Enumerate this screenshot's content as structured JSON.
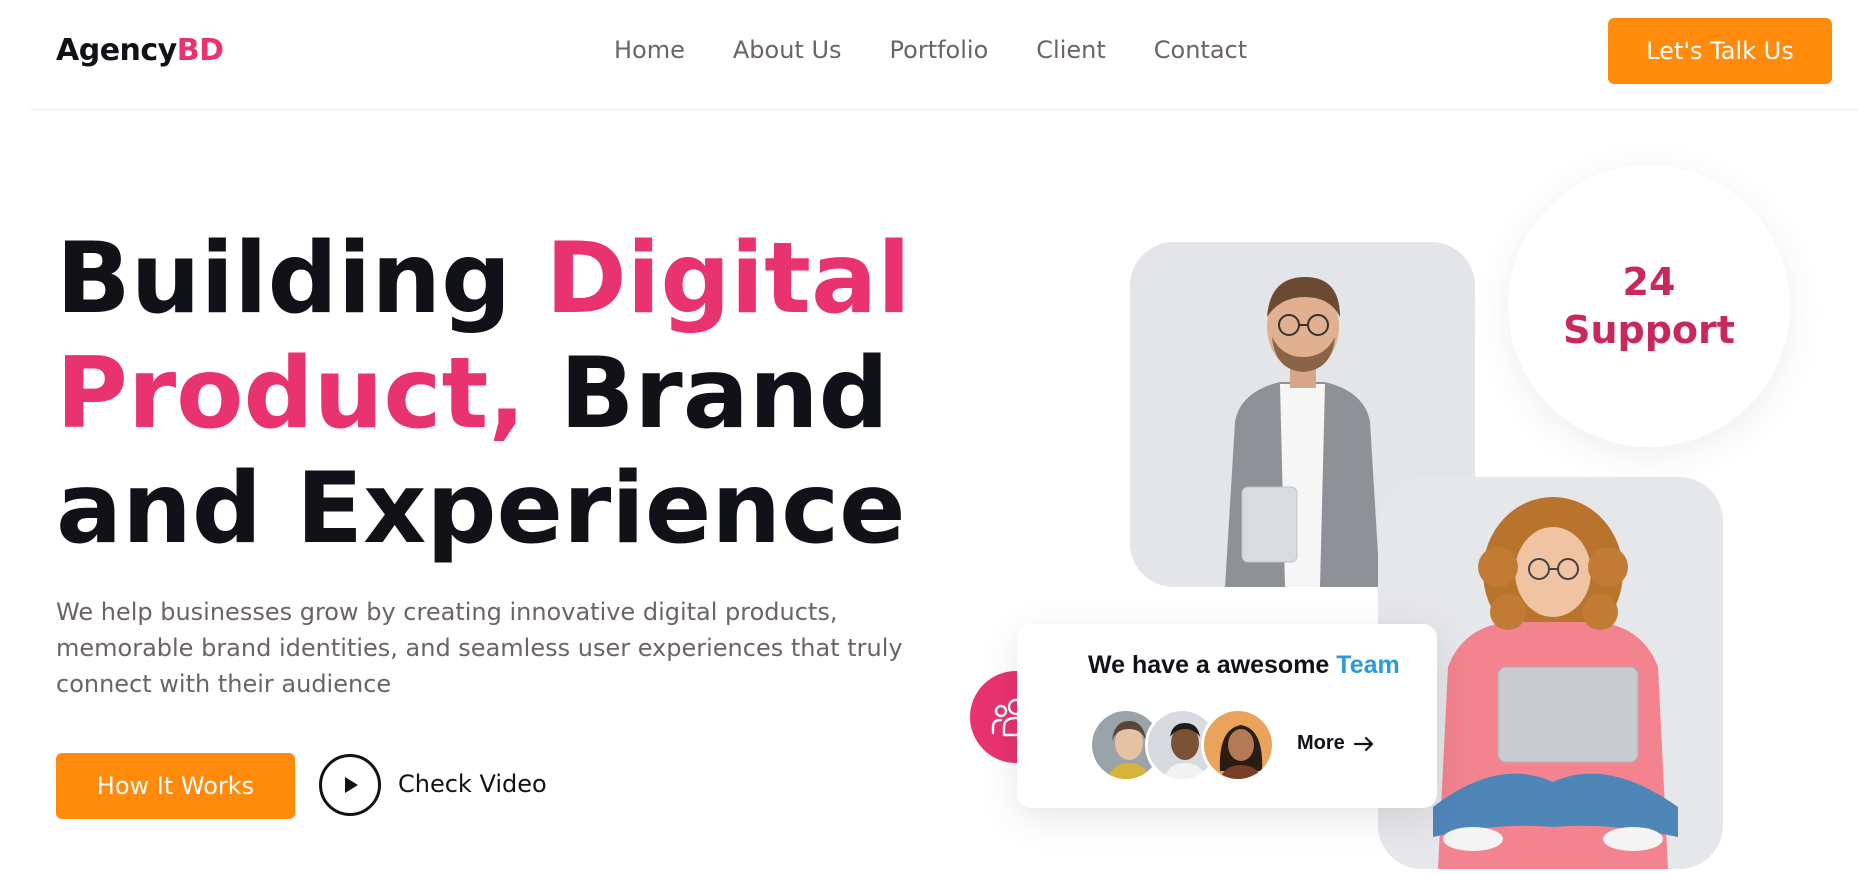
{
  "header": {
    "logo_main": "Agency",
    "logo_accent": "BD",
    "nav": [
      "Home",
      "About Us",
      "Portfolio",
      "Client",
      "Contact"
    ],
    "cta_label": "Let's Talk Us"
  },
  "hero": {
    "headline_part1": "Building ",
    "headline_pink": "Digital Product,",
    "headline_part2": " Brand and Experience",
    "description": "We help businesses grow by creating innovative digital products, memorable brand identities, and seamless user experiences that truly connect with their audience",
    "primary_button": "How It Works",
    "video_label": "Check Video"
  },
  "support_badge": {
    "number": "24",
    "text": "Support"
  },
  "team_card": {
    "title_main": "We have a awesome ",
    "title_accent": "Team",
    "more_label": "More"
  },
  "colors": {
    "accent_pink": "#e8336f",
    "accent_orange": "#ff8a0b",
    "accent_blue": "#2c9ad9",
    "text_dark": "#111118",
    "text_muted": "#6b6463"
  },
  "icons": [
    "play-icon",
    "team-icon",
    "arrow-right-icon"
  ]
}
